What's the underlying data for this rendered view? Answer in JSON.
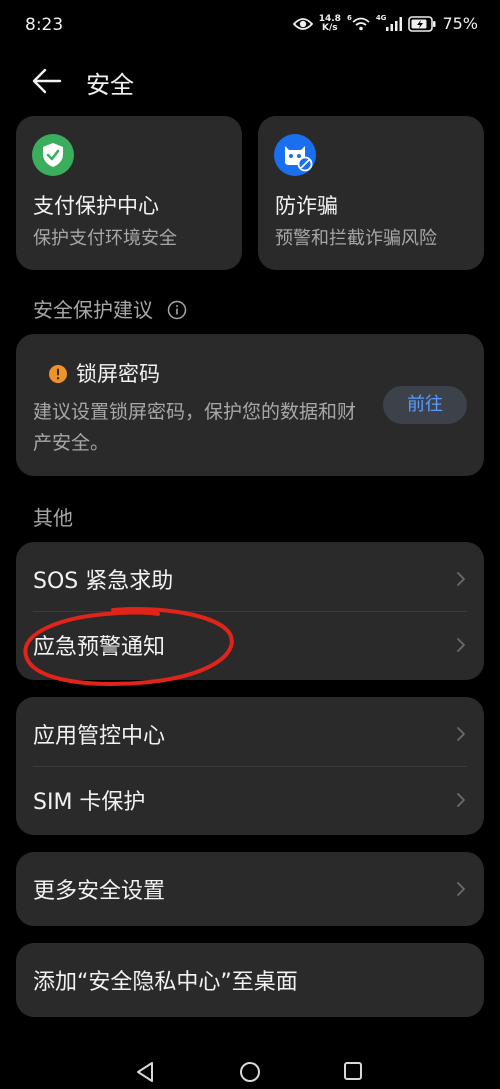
{
  "status_bar": {
    "time": "8:23",
    "speed_value": "14.8",
    "speed_unit": "K/s",
    "net_left": "6",
    "net_right": "4G",
    "battery": "75%"
  },
  "header": {
    "title": "安全"
  },
  "top_cards": [
    {
      "title": "支付保护中心",
      "subtitle": "保护支付环境安全",
      "icon": "shield-check-icon",
      "icon_color": "#3aae5c"
    },
    {
      "title": "防诈骗",
      "subtitle": "预警和拦截诈骗风险",
      "icon": "anti-fraud-icon",
      "icon_color": "#1a6ff0"
    }
  ],
  "suggestions": {
    "header": "安全保护建议",
    "lock_card": {
      "title": "锁屏密码",
      "description": "建议设置锁屏密码，保护您的数据和财产安全。",
      "button": "前往",
      "warn_color": "#f0922a"
    }
  },
  "others": {
    "header": "其他",
    "group1": [
      "SOS 紧急求助",
      "应急预警通知"
    ],
    "group2": [
      "应用管控中心",
      "SIM 卡保护"
    ],
    "group3": [
      "更多安全设置"
    ],
    "group4": [
      "添加“安全隐私中心”至桌面"
    ]
  },
  "accent_color": "#5b9bff",
  "annotation_color": "#e0241a"
}
